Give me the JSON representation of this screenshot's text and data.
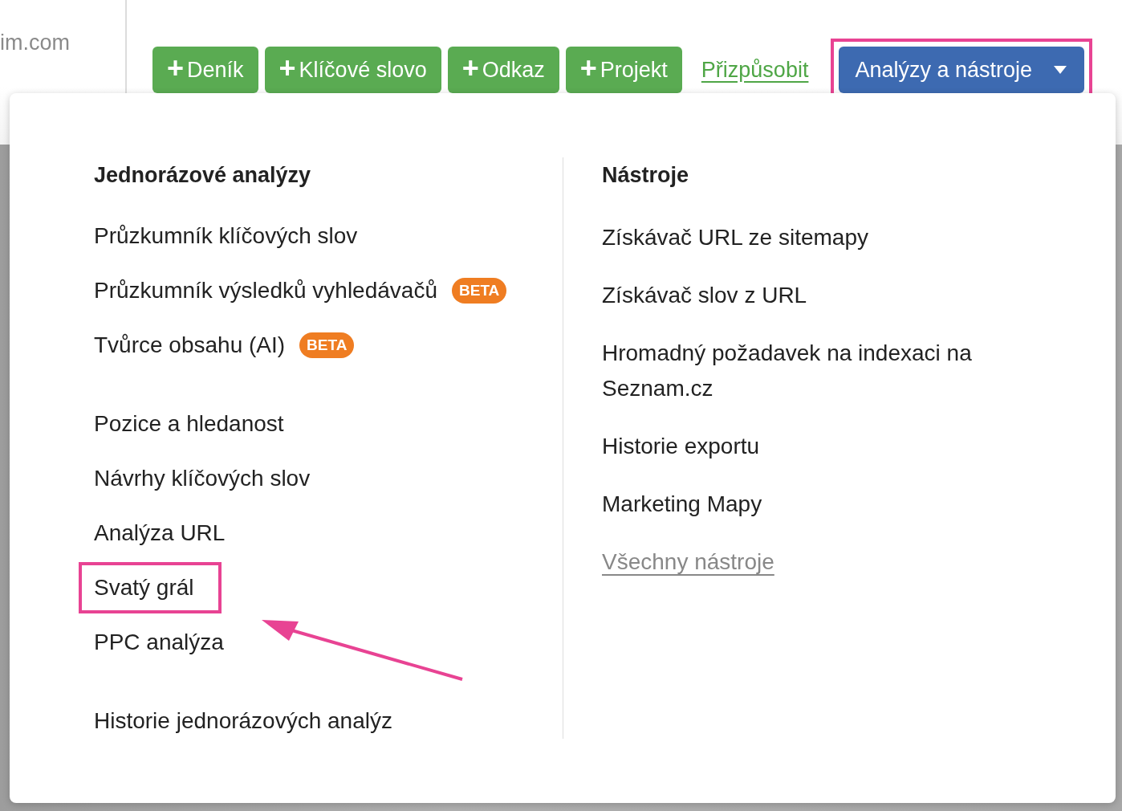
{
  "header": {
    "site_text": "im.com",
    "buttons": [
      {
        "icon": "+",
        "label": "Deník"
      },
      {
        "icon": "+",
        "label": "Klíčové slovo"
      },
      {
        "icon": "+",
        "label": "Odkaz"
      },
      {
        "icon": "+",
        "label": "Projekt"
      }
    ],
    "link": "Přizpůsobit",
    "dropdown": {
      "label": "Analýzy a nástroje",
      "highlighted": true,
      "expanded": true
    }
  },
  "menu": {
    "columns": [
      {
        "heading": "Jednorázové analýzy",
        "groups": [
          [
            {
              "label": "Průzkumník klíčových slov",
              "highlighted": false
            },
            {
              "label": "Průzkumník výsledků vyhledávačů",
              "badge": "BETA",
              "highlighted": false
            },
            {
              "label": "Tvůrce obsahu (AI)",
              "badge": "BETA",
              "highlighted": false
            }
          ],
          [
            {
              "label": "Pozice a hledanost",
              "highlighted": false
            },
            {
              "label": "Návrhy klíčových slov",
              "highlighted": false
            },
            {
              "label": "Analýza URL",
              "highlighted": false
            },
            {
              "label": "Svatý grál",
              "highlighted": true
            },
            {
              "label": "PPC analýza",
              "highlighted": false
            }
          ],
          [
            {
              "label": "Historie jednorázových analýz",
              "highlighted": false
            }
          ]
        ]
      },
      {
        "heading": "Nástroje",
        "groups": [
          [
            {
              "label": "Získávač URL ze sitemapy",
              "highlighted": false
            },
            {
              "label": "Získávač slov z URL",
              "highlighted": false
            },
            {
              "label": "Hromadný požadavek na indexaci na Seznam.cz",
              "highlighted": false
            },
            {
              "label": "Historie exportu",
              "highlighted": false
            },
            {
              "label": "Marketing Mapy",
              "highlighted": false
            },
            {
              "label": "Všechny nástroje",
              "kind": "more",
              "highlighted": false
            }
          ]
        ]
      }
    ]
  }
}
